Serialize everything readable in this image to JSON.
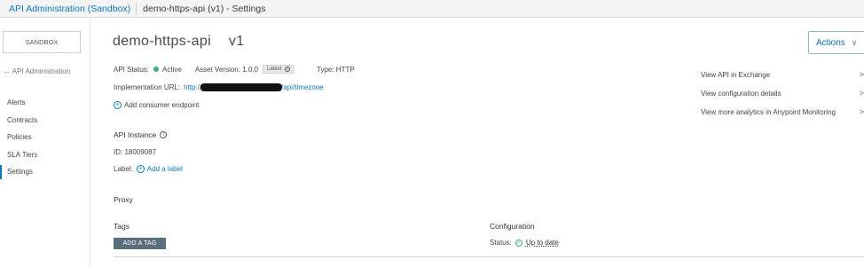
{
  "breadcrumb": {
    "app": "API Administration (Sandbox)",
    "current": "demo-https-api (v1) - Settings"
  },
  "sidebar": {
    "environment": "SANDBOX",
    "back_link": "← API Administration",
    "items": [
      {
        "label": "Alerts"
      },
      {
        "label": "Contracts"
      },
      {
        "label": "Policies"
      },
      {
        "label": "SLA Tiers"
      },
      {
        "label": "Settings"
      }
    ]
  },
  "header": {
    "api_name": "demo-https-api",
    "version": "v1",
    "actions_label": "Actions"
  },
  "details": {
    "api_status_label": "API Status:",
    "api_status_value": "Active",
    "asset_version_label": "Asset Version: 1.0.0",
    "latest_badge": "Latest",
    "type_label": "Type: HTTP",
    "implementation_url_label": "Implementation URL:",
    "implementation_url_prefix": "http://",
    "implementation_url_suffix": "/api/timezone",
    "add_consumer_endpoint": "Add consumer endpoint"
  },
  "instance": {
    "heading": "API Instance",
    "id_label": "ID: 18009087",
    "label_label": "Label:",
    "add_label": "Add a label"
  },
  "proxy": {
    "heading": "Proxy"
  },
  "tags": {
    "heading": "Tags",
    "add_button": "ADD A TAG"
  },
  "configuration": {
    "heading": "Configuration",
    "status_label": "Status:",
    "status_value": "Up to date"
  },
  "right_links": [
    {
      "label": "View API in Exchange"
    },
    {
      "label": "View configuration details"
    },
    {
      "label": "View more analytics in Anypoint Monitoring"
    }
  ],
  "colors": {
    "accent": "#0a78c2",
    "status_active": "#2eb872",
    "tag_button": "#5a6f7d"
  }
}
